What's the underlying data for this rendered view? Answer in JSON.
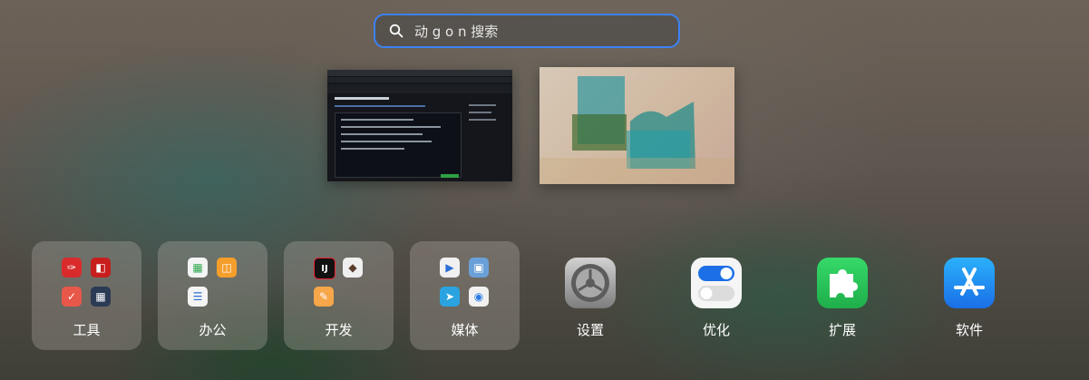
{
  "search": {
    "value": "动 g o n 搜索"
  },
  "windows": [
    {
      "name": "browser-window"
    },
    {
      "name": "image-viewer-window"
    }
  ],
  "folders": [
    {
      "label": "工具"
    },
    {
      "label": "办公"
    },
    {
      "label": "开发"
    },
    {
      "label": "媒体"
    }
  ],
  "apps": [
    {
      "label": "设置"
    },
    {
      "label": "优化"
    },
    {
      "label": "扩展"
    },
    {
      "label": "软件"
    }
  ],
  "colors": {
    "search_border": "#3b82f6",
    "extension_green": "#22c55e",
    "appstore_blue": "#1a82f7"
  }
}
